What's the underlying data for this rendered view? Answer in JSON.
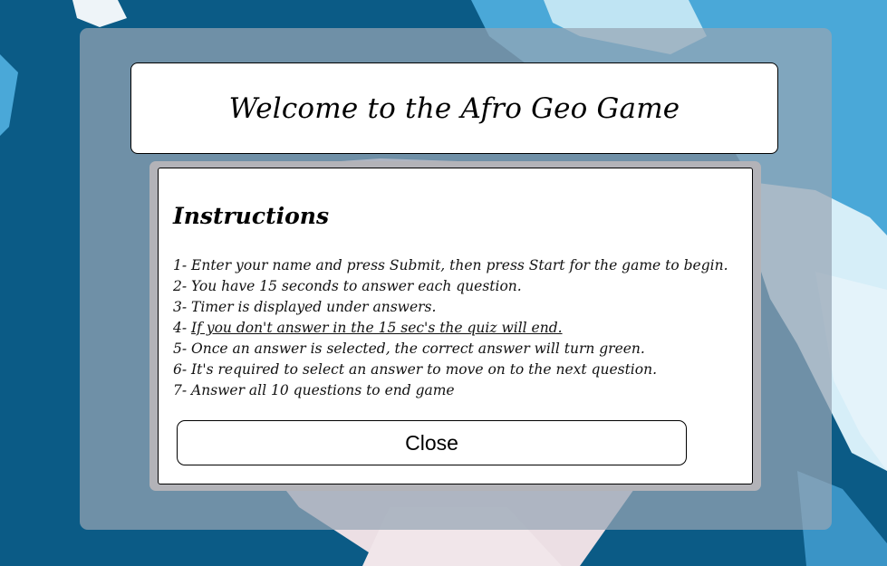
{
  "title": "Welcome to the Afro Geo Game",
  "instructions": {
    "heading": "Instructions",
    "items": [
      "1- Enter your name and press Submit, then press Start for the game to begin.",
      "2- You have 15 seconds to answer each question.",
      "3- Timer is displayed under answers.",
      "4- ",
      "5- Once an answer is selected, the correct answer will turn green.",
      "6- It's required to select an answer to move on to the next question.",
      "7- Answer all 10 questions to end game"
    ],
    "item4_emphasis": "If you don't answer in the 15 sec's the quiz will end."
  },
  "close_button": "Close"
}
